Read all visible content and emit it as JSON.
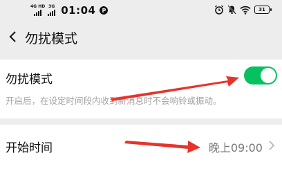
{
  "status_bar": {
    "network_label_1": "4G HD",
    "network_label_2": "3G",
    "time": "01:04",
    "notification_icon": "circle-p-icon",
    "alarm_icon": "alarm-icon",
    "mute_icon": "bell-off-icon",
    "wifi_icon": "wifi-icon",
    "battery": "31"
  },
  "nav": {
    "back_icon": "chevron-left-icon",
    "title": "勿扰模式"
  },
  "dnd": {
    "label": "勿扰模式",
    "description": "开启后，在设定时间段内收到新消息时不会响铃或振动。",
    "enabled": true,
    "toggle_color": "#07c160"
  },
  "start_time": {
    "label": "开始时间",
    "value": "晚上09:00",
    "chevron_icon": "chevron-right-icon"
  },
  "annotations": {
    "arrow_color": "#e8332a"
  }
}
